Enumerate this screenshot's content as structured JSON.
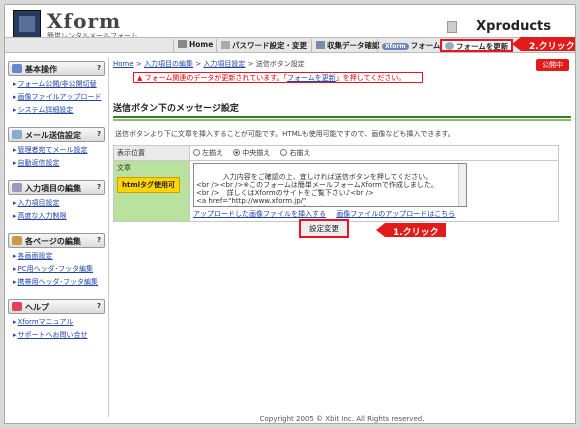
{
  "header": {
    "logo_text": "Xform",
    "logo_sub": "簡単レンタルメールフォーム",
    "brand_right": "Xproducts"
  },
  "nav": {
    "items": [
      "Home",
      "パスワード設定・変更",
      "収集データ確認",
      "フォームを見る",
      "フォームを更新"
    ],
    "pill": "Xform",
    "callout": "2.クリック"
  },
  "status_pill": "公開中",
  "sidebar": {
    "sections": [
      {
        "title": "基本操作",
        "links": [
          "フォーム公開/非公開切替",
          "画像ファイルアップロード",
          "システム詳細設定"
        ]
      },
      {
        "title": "メール送信設定",
        "links": [
          "管理者宛てメール設定",
          "自動返信設定"
        ]
      },
      {
        "title": "入力項目の編集",
        "links": [
          "入力項目設定",
          "高度な入力制限"
        ]
      },
      {
        "title": "各ページの編集",
        "links": [
          "各画面設定",
          "PC用ヘッダ･フッタ編集",
          "携帯用ヘッダ･フッタ編集"
        ]
      },
      {
        "title": "ヘルプ",
        "links": [
          "Xformマニュアル",
          "サポートへお問い合せ"
        ]
      }
    ]
  },
  "breadcrumb": {
    "home": "Home",
    "items": [
      "入力項目の編集",
      "入力項目設定"
    ],
    "current": "送信ボタン設定",
    "sep": ">"
  },
  "alert": {
    "before": "フォーム関連のデータが更新されています。「",
    "link": "フォームを更新",
    "after": "」を押してください。"
  },
  "section": {
    "title": "送信ボタン下のメッセージ設定",
    "desc": "送信ボタンより下に文章を挿入することが可能です。HTMLも使用可能ですので、画像なども挿入できます。"
  },
  "form": {
    "position_label": "表示位置",
    "radios": [
      "左揃え",
      "中央揃え",
      "右揃え"
    ],
    "selected": "中央揃え",
    "text_label": "文章",
    "html_button": "htmlタグ使用可",
    "textarea_value": "入力内容をご確認の上、宜しければ送信ボタンを押してください。\n<br /><br />※このフォームは簡単メールフォームXformで作成しました。\n<br />　詳しくはXformのサイトをご覧下さい♪<br />\n<a href=\"http://www.xform.jp/\"\ntarget=\"_blank\">http://www.xform.jp/</a>",
    "link_insert": "アップロードした画像ファイルを挿入する",
    "link_list": "画像ファイルのアップロードはこちら",
    "submit": "設定変更",
    "callout": "1.クリック"
  },
  "footer": "Copyright 2005 © Xbit Inc. All Rights reserved.",
  "colors": {
    "accent": "#e21a1a",
    "green": "#3a7a2a",
    "link": "#2244aa"
  }
}
